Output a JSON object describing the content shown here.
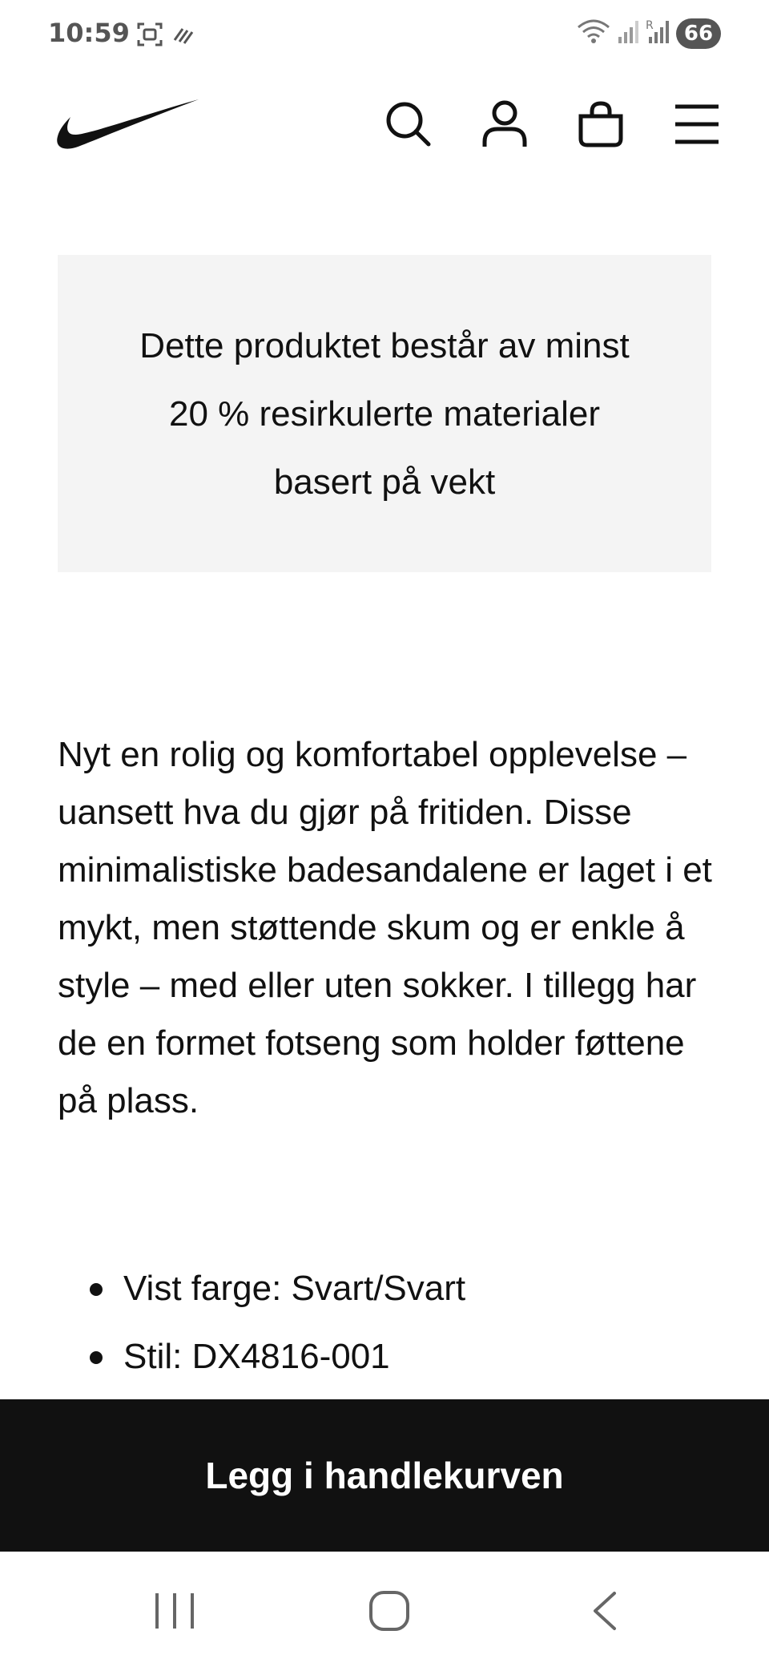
{
  "status_bar": {
    "time": "10:59",
    "battery": "66",
    "left_icons": [
      "screenshot-icon",
      "nfc-icon"
    ],
    "right_icons": [
      "wifi-icon",
      "signal-icon",
      "signal-roaming-icon",
      "battery-icon"
    ]
  },
  "header": {
    "logo": "nike-swoosh-logo",
    "icons": [
      "search-icon",
      "account-icon",
      "bag-icon",
      "menu-icon"
    ]
  },
  "notice": {
    "text": "Dette produktet består av minst 20 % resirkulerte materialer basert på vekt"
  },
  "product": {
    "description": "Nyt en rolig og komfortabel opplevelse – uansett hva du gjør på fritiden. Disse minimalistiske badesandalene er laget i et mykt, men støttende skum og er enkle å style – med eller uten sokker. I tillegg har de en formet fotseng som holder føttene på plass.",
    "details": [
      {
        "text": "Vist farge: Svart/Svart"
      },
      {
        "text": "Stil: DX4816-001"
      }
    ]
  },
  "cta": {
    "add_to_cart_label": "Legg i handlekurven"
  },
  "nav_bar": {
    "icons": [
      "recent-apps-icon",
      "home-icon",
      "back-icon"
    ]
  },
  "colors": {
    "primary": "#111111",
    "notice_background": "#f4f4f4",
    "background": "#ffffff"
  }
}
